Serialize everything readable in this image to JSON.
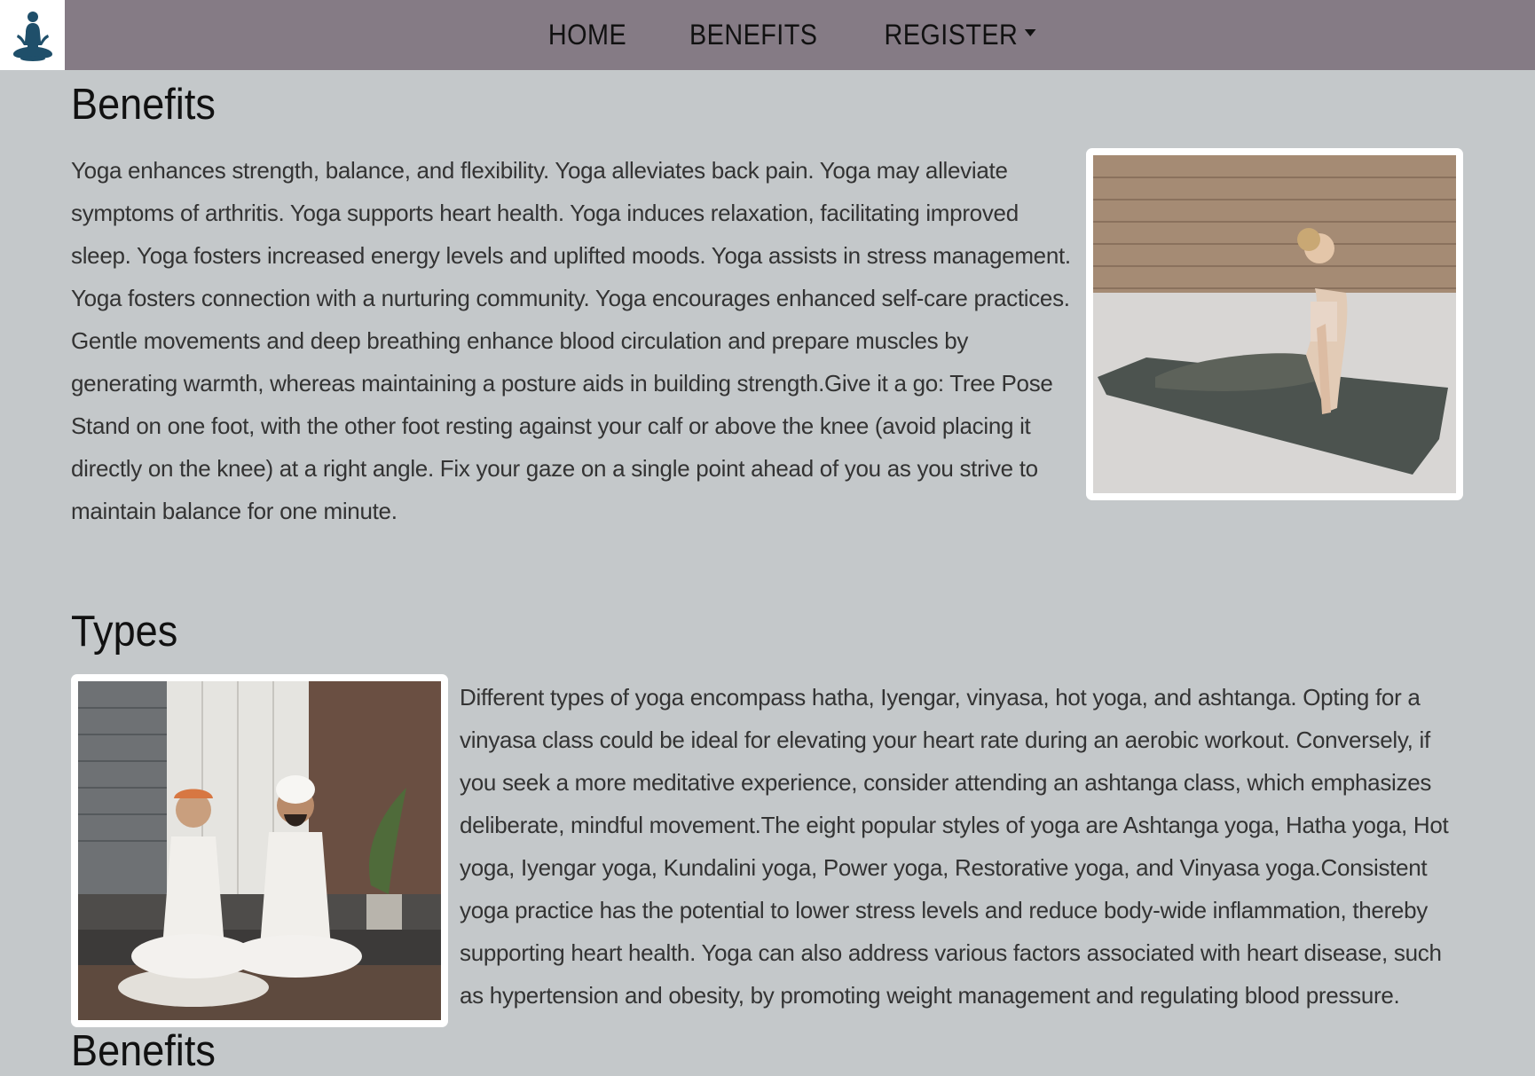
{
  "nav": {
    "items": [
      {
        "label": "HOME"
      },
      {
        "label": "BENEFITS"
      },
      {
        "label": "REGISTER"
      }
    ]
  },
  "benefits": {
    "heading": "Benefits",
    "text": "Yoga enhances strength, balance, and flexibility. Yoga alleviates back pain. Yoga may alleviate symptoms of arthritis. Yoga supports heart health. Yoga induces relaxation, facilitating improved sleep. Yoga fosters increased energy levels and uplifted moods. Yoga assists in stress management. Yoga fosters connection with a nurturing community. Yoga encourages enhanced self-care practices. Gentle movements and deep breathing enhance blood circulation and prepare muscles by generating warmth, whereas maintaining a posture aids in building strength.Give it a go: Tree Pose Stand on one foot, with the other foot resting against your calf or above the knee (avoid placing it directly on the knee) at a right angle. Fix your gaze on a single point ahead of you as you strive to maintain balance for one minute."
  },
  "types": {
    "heading": "Types",
    "text": "Different types of yoga encompass hatha, Iyengar, vinyasa, hot yoga, and ashtanga. Opting for a vinyasa class could be ideal for elevating your heart rate during an aerobic workout. Conversely, if you seek a more meditative experience, consider attending an ashtanga class, which emphasizes deliberate, mindful movement.The eight popular styles of yoga are Ashtanga yoga, Hatha yoga, Hot yoga, Iyengar yoga, Kundalini yoga, Power yoga, Restorative yoga, and Vinyasa yoga.Consistent yoga practice has the potential to lower stress levels and reduce body-wide inflammation, thereby supporting heart health. Yoga can also address various factors associated with heart disease, such as hypertension and obesity, by promoting weight management and regulating blood pressure."
  },
  "next_heading": "Benefits",
  "colors": {
    "navbar": "#857b85",
    "background": "#c4c8ca",
    "logo": "#1f4f6a"
  },
  "icons": {
    "logo": "meditation-icon",
    "dropdown": "caret-down-icon"
  }
}
